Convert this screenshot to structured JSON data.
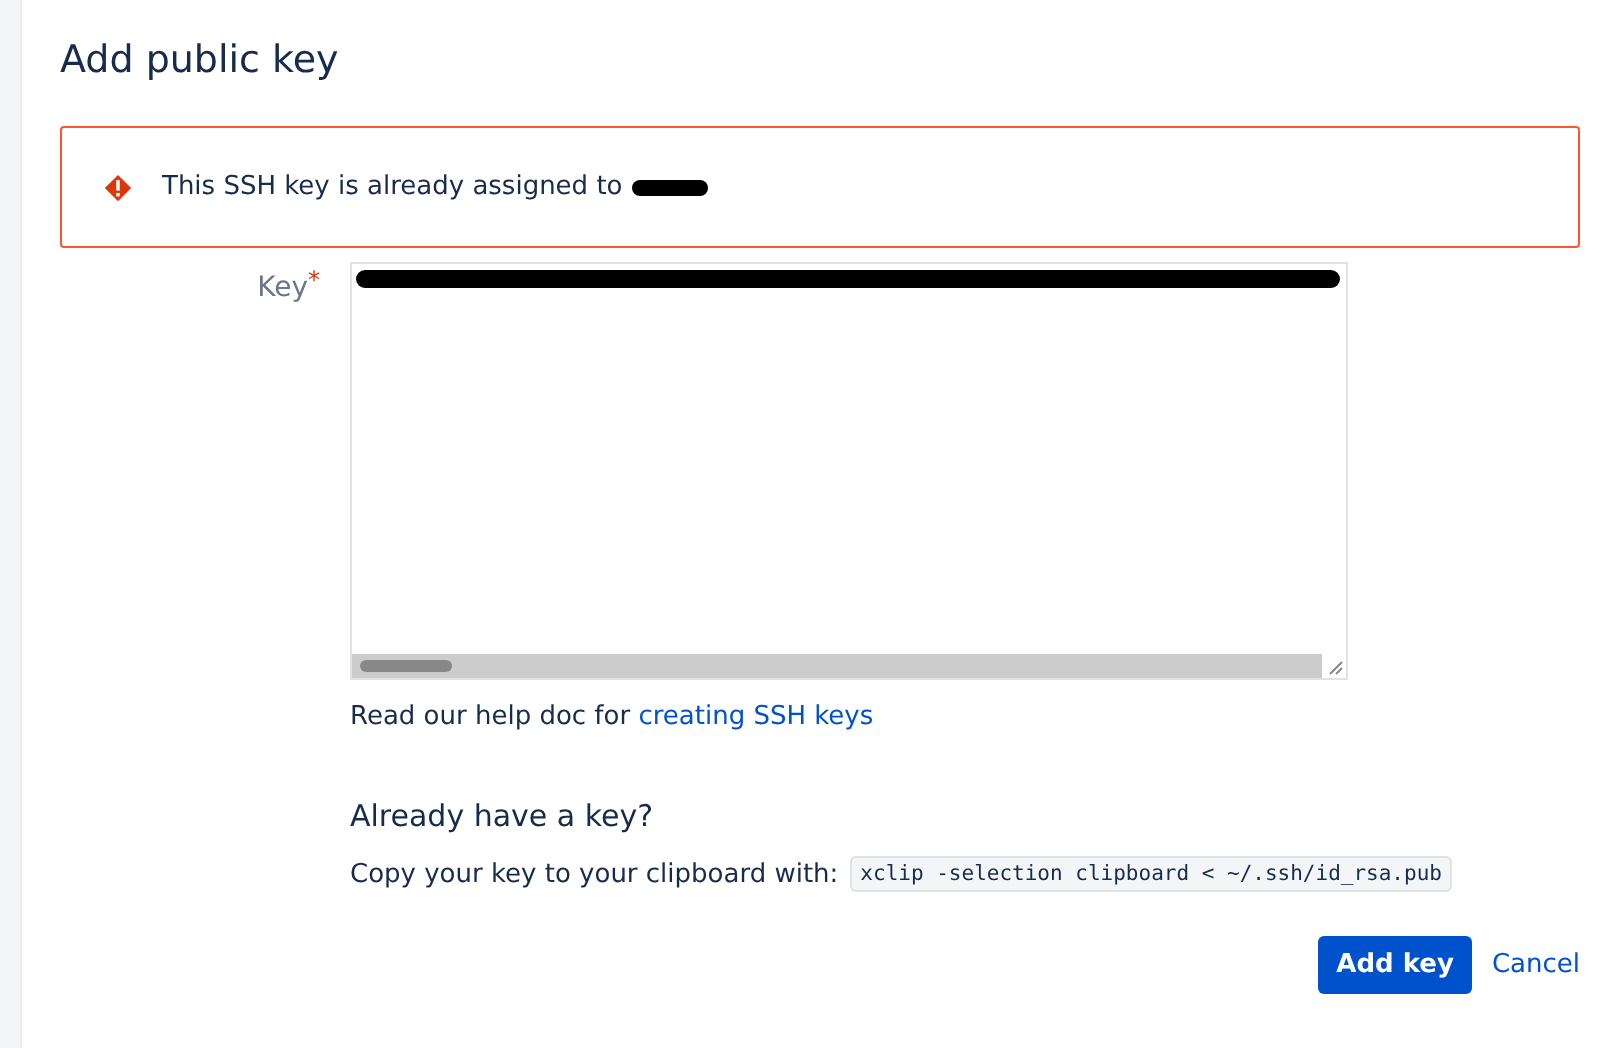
{
  "title": "Add public key",
  "alert": {
    "message": "This SSH key is already assigned to",
    "redacted": true
  },
  "key_field": {
    "label": "Key",
    "required_marker": "*",
    "redacted": true
  },
  "help": {
    "text": "Read our help doc for",
    "link": "creating SSH keys"
  },
  "existing": {
    "heading": "Already have a key?",
    "text": "Copy your key to your clipboard with:",
    "command": "xclip -selection clipboard < ~/.ssh/id_rsa.pub"
  },
  "buttons": {
    "primary": "Add key",
    "cancel": "Cancel"
  }
}
